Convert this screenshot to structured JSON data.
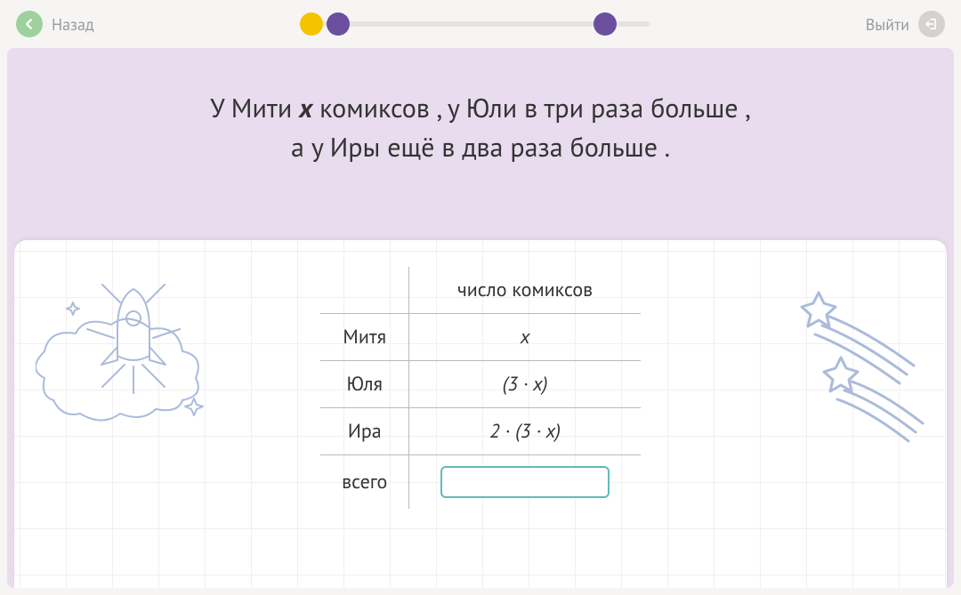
{
  "topbar": {
    "back_label": "Назад",
    "exit_label": "Выйти"
  },
  "prompt": {
    "line1_pre": "У Мити ",
    "line1_var": "x",
    "line1_post": " комиксов ,  у Юли в три раза больше ,",
    "line2": "а у Иры ещё в два раза больше ."
  },
  "table": {
    "header_blank": "",
    "header_count": "число комиксов",
    "rows": [
      {
        "name": "Митя",
        "value": "x"
      },
      {
        "name": "Юля",
        "value": "(3 · x)"
      },
      {
        "name": "Ира",
        "value": "2 · (3 · x)"
      }
    ],
    "total_label": "всего",
    "total_value": ""
  }
}
